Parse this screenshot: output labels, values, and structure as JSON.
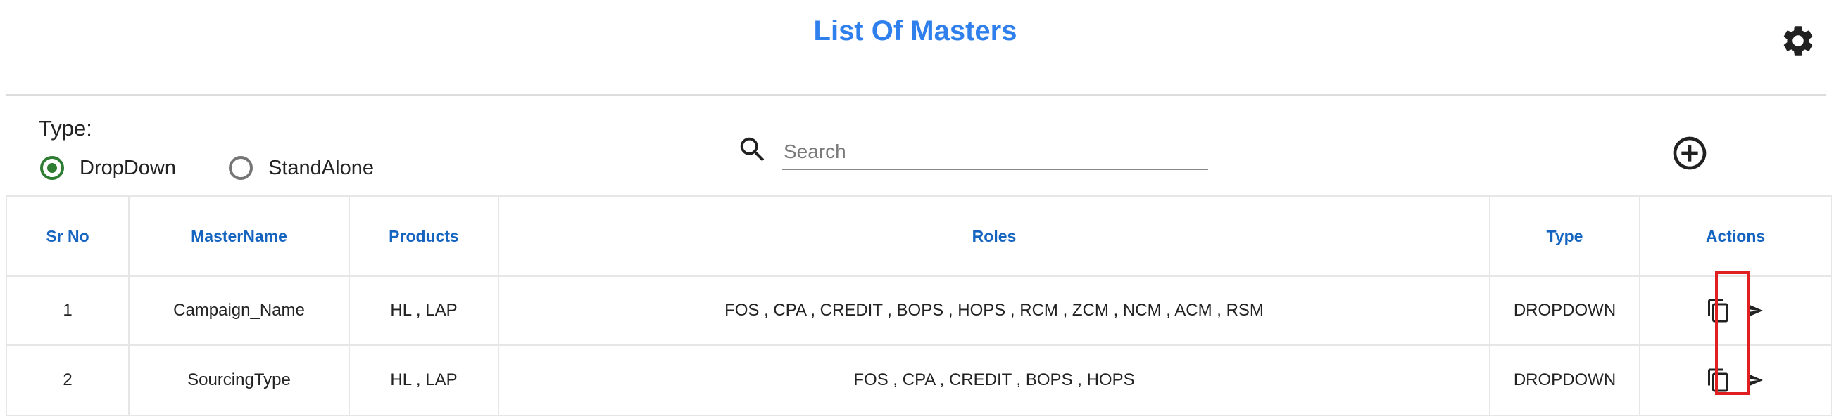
{
  "header": {
    "title": "List Of Masters",
    "settings_icon": "gear-icon"
  },
  "filters": {
    "type_label": "Type:",
    "options": [
      {
        "label": "DropDown",
        "selected": true
      },
      {
        "label": "StandAlone",
        "selected": false
      }
    ],
    "search": {
      "placeholder": "Search",
      "value": ""
    },
    "add_icon": "add-circle-icon"
  },
  "table": {
    "columns": [
      "Sr No",
      "MasterName",
      "Products",
      "Roles",
      "Type",
      "Actions"
    ],
    "rows": [
      {
        "sr": "1",
        "name": "Campaign_Name",
        "products": "HL , LAP",
        "roles": "FOS , CPA , CREDIT , BOPS , HOPS , RCM , ZCM , NCM , ACM , RSM",
        "type": "DROPDOWN"
      },
      {
        "sr": "2",
        "name": "SourcingType",
        "products": "HL , LAP",
        "roles": "FOS , CPA , CREDIT , BOPS , HOPS",
        "type": "DROPDOWN"
      }
    ],
    "action_icons": [
      "copy-icon",
      "send-icon"
    ]
  },
  "colors": {
    "title": "#2f80ed",
    "header_text": "#1565c0",
    "radio_selected": "#2e7d32",
    "highlight": "#e02020"
  }
}
